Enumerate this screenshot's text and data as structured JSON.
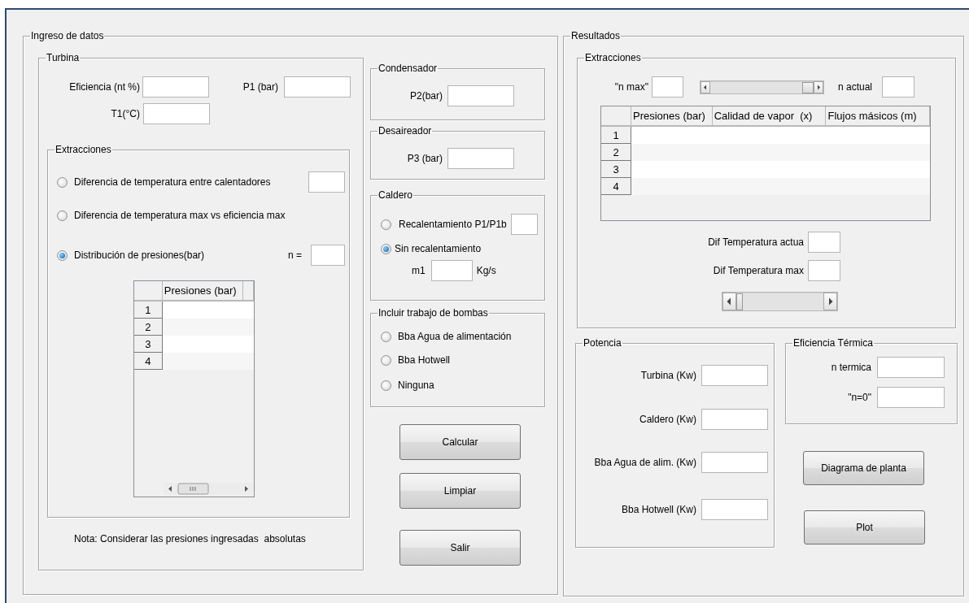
{
  "ingreso": {
    "title": "Ingreso de datos",
    "turbina": {
      "title": "Turbina",
      "fields": [
        {
          "label": "Eficiencia (nt %)"
        },
        {
          "label": "P1 (bar)"
        },
        {
          "label": "T1(°C)"
        }
      ],
      "extracciones": {
        "title": "Extracciones",
        "options": [
          {
            "label": "Diferencia de temperatura entre calentadores",
            "selected": false
          },
          {
            "label": "Diferencia de temperatura max vs eficiencia max",
            "selected": false
          },
          {
            "label": "Distribución de presiones(bar)",
            "selected": true
          }
        ],
        "n_label": "n =",
        "table": {
          "columns": [
            "Presiones (bar)"
          ],
          "rows": [
            "1",
            "2",
            "3",
            "4"
          ]
        }
      },
      "note": "Nota: Considerar las presiones ingresadas  absolutas"
    },
    "condensador": {
      "title": "Condensador",
      "label": "P2(bar)"
    },
    "desaireador": {
      "title": "Desaireador",
      "label": "P3 (bar)"
    },
    "caldero": {
      "title": "Caldero",
      "options": [
        {
          "label": "Recalentamiento P1/P1b",
          "selected": false
        },
        {
          "label": "Sin recalentamiento",
          "selected": true
        }
      ],
      "m1_label": "m1",
      "m1_unit": "Kg/s"
    },
    "bombas": {
      "title": "Incluir trabajo de bombas",
      "options": [
        {
          "label": "Bba Agua de alimentación",
          "selected": false
        },
        {
          "label": "Bba Hotwell",
          "selected": false
        },
        {
          "label": "Ninguna",
          "selected": false
        }
      ]
    },
    "buttons": [
      "Calcular",
      "Limpiar",
      "Salir"
    ]
  },
  "resultados": {
    "title": "Resultados",
    "extracciones": {
      "title": "Extracciones",
      "n_max_label": "\"n max\"",
      "n_slider": {
        "level": 1
      },
      "n_actual_label": "n actual",
      "table": {
        "columns": [
          "Presiones (bar)",
          "Calidad de vapor  (x)",
          "Flujos másicos (m)"
        ],
        "rows": [
          "1",
          "2",
          "3",
          "4"
        ]
      },
      "dif_actual_label": "Dif Temperatura actua",
      "dif_max_label": "Dif Temperatura max",
      "dif_slider": {
        "level": 0
      }
    },
    "potencia": {
      "title": "Potencia",
      "fields": [
        {
          "label": "Turbina (Kw)"
        },
        {
          "label": "Caldero (Kw)"
        },
        {
          "label": "Bba Agua de alim. (Kw)"
        },
        {
          "label": "Bba Hotwell (Kw)"
        }
      ]
    },
    "eficiencia": {
      "title": "Eficiencia Térmica",
      "fields": [
        {
          "label": "n termica"
        },
        {
          "label": "\"n=0\""
        }
      ]
    },
    "buttons": [
      "Diagrama de planta",
      "Plot"
    ]
  }
}
